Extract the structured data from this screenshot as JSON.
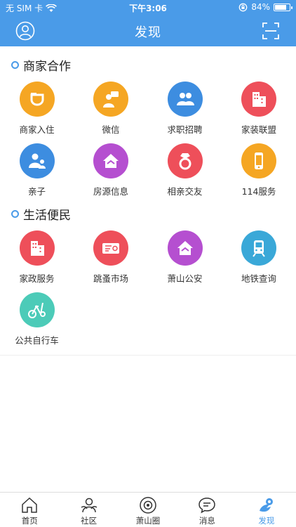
{
  "status": {
    "carrier": "无 SIM 卡",
    "time": "下午3:06",
    "battery": "84%",
    "battery_level": 0.84
  },
  "header": {
    "title": "发现"
  },
  "sections": [
    {
      "title": "商家合作",
      "items": [
        {
          "label": "商家入住",
          "icon": "didi-icon",
          "color": "#f5a623"
        },
        {
          "label": "微信",
          "icon": "person-chat-icon",
          "color": "#f5a623"
        },
        {
          "label": "求职招聘",
          "icon": "people-icon",
          "color": "#3d8de0"
        },
        {
          "label": "家装联盟",
          "icon": "building-icon",
          "color": "#ee4f5a"
        },
        {
          "label": "亲子",
          "icon": "parent-child-icon",
          "color": "#3d8de0"
        },
        {
          "label": "房源信息",
          "icon": "house-icon",
          "color": "#b54fd0"
        },
        {
          "label": "相亲交友",
          "icon": "ring-icon",
          "color": "#ee4f5a"
        },
        {
          "label": "114服务",
          "icon": "phone-icon",
          "color": "#f5a623"
        }
      ]
    },
    {
      "title": "生活便民",
      "items": [
        {
          "label": "家政服务",
          "icon": "building-icon",
          "color": "#ee4f5a"
        },
        {
          "label": "跳蚤市场",
          "icon": "ticket-icon",
          "color": "#ee4f5a"
        },
        {
          "label": "萧山公安",
          "icon": "house-icon",
          "color": "#b54fd0"
        },
        {
          "label": "地铁查询",
          "icon": "train-icon",
          "color": "#3aa8d8"
        },
        {
          "label": "公共自行车",
          "icon": "bike-icon",
          "color": "#4ccbb8"
        }
      ]
    }
  ],
  "tabs": [
    {
      "label": "首页",
      "icon": "home-icon",
      "active": false
    },
    {
      "label": "社区",
      "icon": "community-icon",
      "active": false
    },
    {
      "label": "萧山圈",
      "icon": "circle-eye-icon",
      "active": false
    },
    {
      "label": "消息",
      "icon": "message-icon",
      "active": false
    },
    {
      "label": "发现",
      "icon": "discover-icon",
      "active": true
    }
  ],
  "colors": {
    "primary": "#4a9be8"
  }
}
